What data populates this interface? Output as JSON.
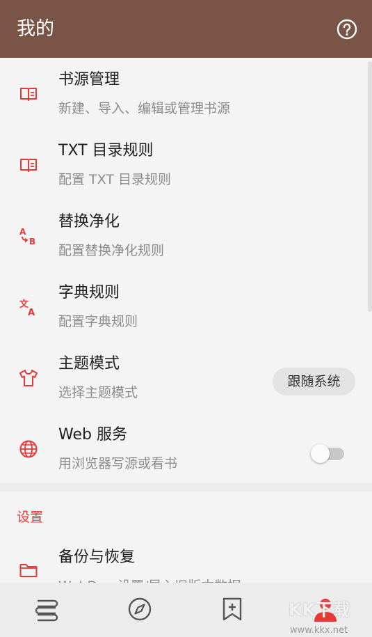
{
  "appbar": {
    "title": "我的",
    "help_icon": "help-circle-icon"
  },
  "colors": {
    "appbar": "#7a5547",
    "accent": "#e53935"
  },
  "items": [
    {
      "title": "书源管理",
      "subtitle": "新建、导入、编辑或管理书源",
      "icon": "book-open-icon"
    },
    {
      "title": "TXT 目录规则",
      "subtitle": "配置 TXT 目录规则",
      "icon": "book-open-icon"
    },
    {
      "title": "替换净化",
      "subtitle": "配置替换净化规则",
      "icon": "find-replace-icon"
    },
    {
      "title": "字典规则",
      "subtitle": "配置字典规则",
      "icon": "translate-icon"
    },
    {
      "title": "主题模式",
      "subtitle": "选择主题模式",
      "icon": "shirt-icon",
      "value": "跟随系统"
    },
    {
      "title": "Web 服务",
      "subtitle": "用浏览器写源或看书",
      "icon": "globe-icon",
      "enabled": false
    }
  ],
  "section": {
    "title": "设置"
  },
  "settings_items": [
    {
      "title": "备份与恢复",
      "subtitle": "WebDav 设置/导入旧版本数据",
      "icon": "folder-icon"
    }
  ],
  "bottom_nav": [
    {
      "name": "bookshelf",
      "icon": "bookshelf-icon"
    },
    {
      "name": "discover",
      "icon": "compass-icon"
    },
    {
      "name": "rss",
      "icon": "bookmark-add-icon"
    },
    {
      "name": "my",
      "icon": "person-icon",
      "active": true
    }
  ],
  "watermark": {
    "text": "KK下载",
    "url": "www.kkx.net"
  }
}
